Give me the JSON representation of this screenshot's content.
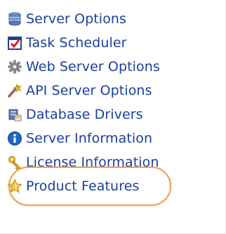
{
  "menu": {
    "items": [
      {
        "label": "Server Options",
        "icon": "server-stack-icon"
      },
      {
        "label": "Task Scheduler",
        "icon": "task-scheduler-icon"
      },
      {
        "label": "Web Server Options",
        "icon": "web-server-gear-icon"
      },
      {
        "label": "API Server Options",
        "icon": "api-wand-icon"
      },
      {
        "label": "Database Drivers",
        "icon": "database-driver-icon"
      },
      {
        "label": "Server Information",
        "icon": "info-icon"
      },
      {
        "label": "License Information",
        "icon": "key-icon"
      },
      {
        "label": "Product Features",
        "icon": "star-icon"
      }
    ]
  },
  "colors": {
    "link": "#1a3fa0",
    "highlight": "#f0a04b"
  }
}
